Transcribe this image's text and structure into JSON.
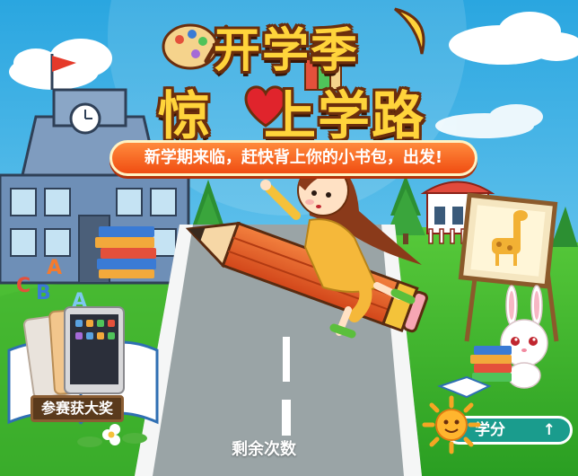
{
  "title": {
    "line1": "开学季",
    "line2_part1": "惊",
    "line2_part2": "上学路"
  },
  "slogan": "新学期来临，赶快背上你的小书包，出发!",
  "award_label": "参赛获大奖",
  "remaining_label": "剩余次数",
  "score_button": {
    "label": "学分",
    "icon": "arrow-up-icon",
    "arrow_glyph": "↑"
  },
  "books_letters": [
    "A",
    "B",
    "C",
    "A"
  ],
  "colors": {
    "sky": "#35b6e8",
    "grass": "#3ab42f",
    "road": "#9aa4a6",
    "title": "#ffd43b",
    "slogan_bg": "#f25a18",
    "score_btn": "#1a9c8d"
  }
}
